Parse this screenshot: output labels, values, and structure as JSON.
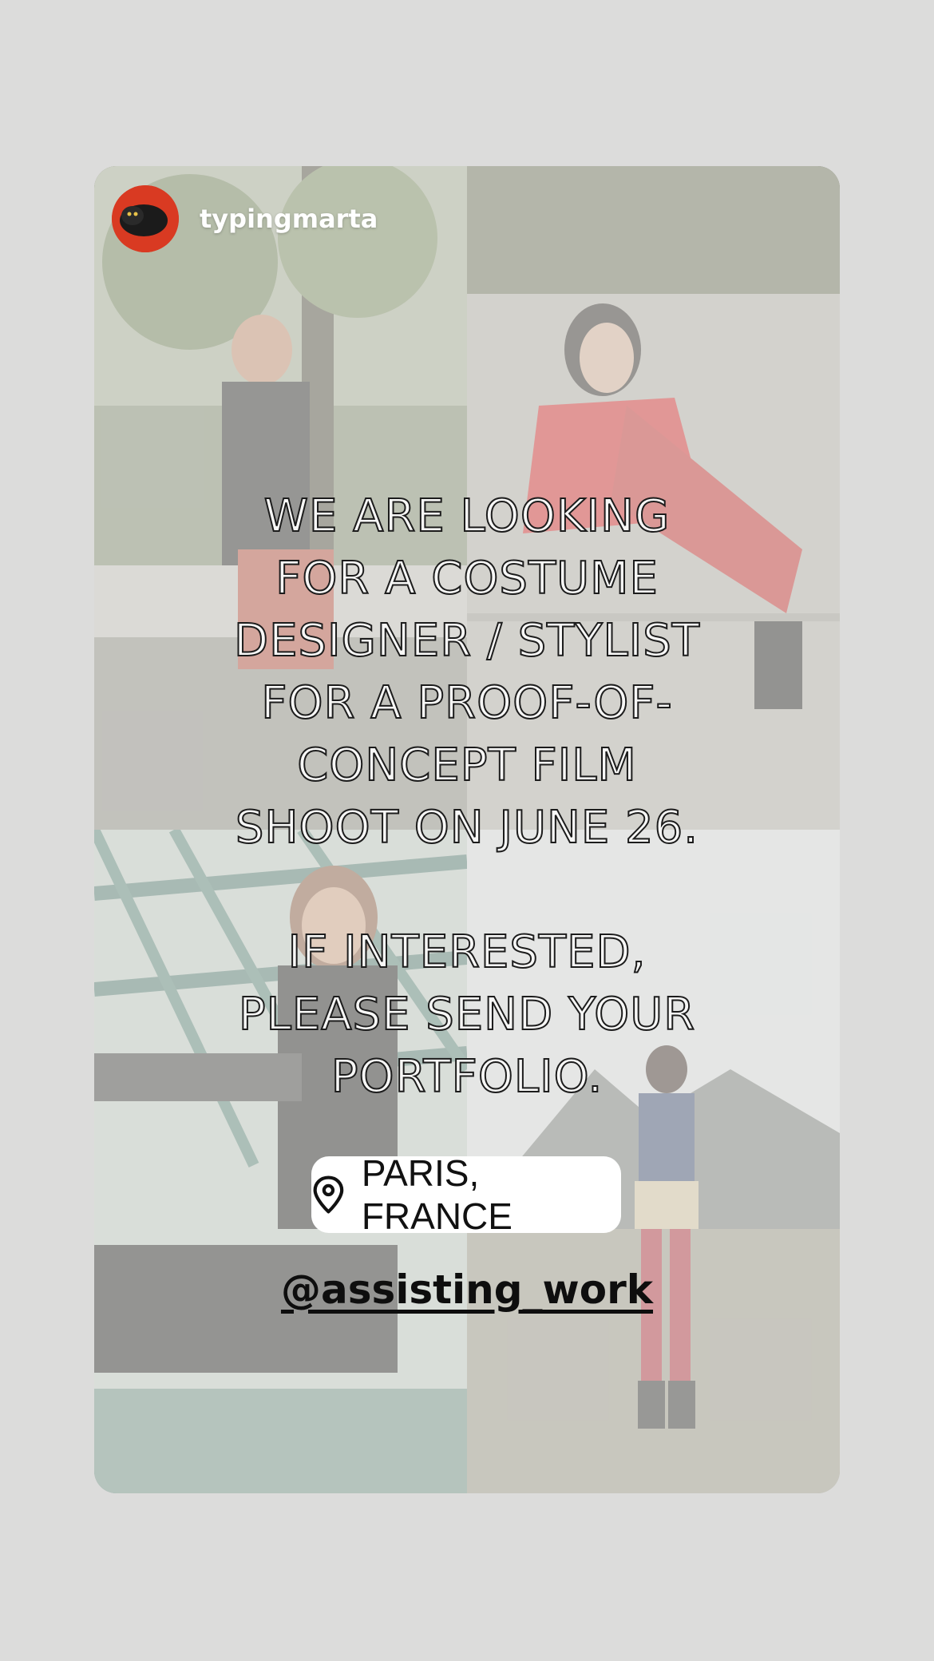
{
  "story": {
    "username": "typingmarta",
    "announcement": {
      "line1": "WE ARE LOOKING",
      "line2": "FOR A COSTUME",
      "line3": "DESIGNER / STYLIST",
      "line4": "FOR A PROOF-OF-",
      "line5": "CONCEPT FILM",
      "line6": "SHOOT ON JUNE 26.",
      "line7": "IF INTERESTED,",
      "line8": "PLEASE SEND YOUR",
      "line9": "PORTFOLIO."
    },
    "location": {
      "icon": "location-pin-icon",
      "label": "PARIS, FRANCE"
    },
    "mention": "@assisting_work"
  },
  "colors": {
    "page_background": "#dcdcdb",
    "avatar_ring": "#d93a22",
    "sticker_background": "#ffffff",
    "text_outline": "#1c1c1c"
  }
}
